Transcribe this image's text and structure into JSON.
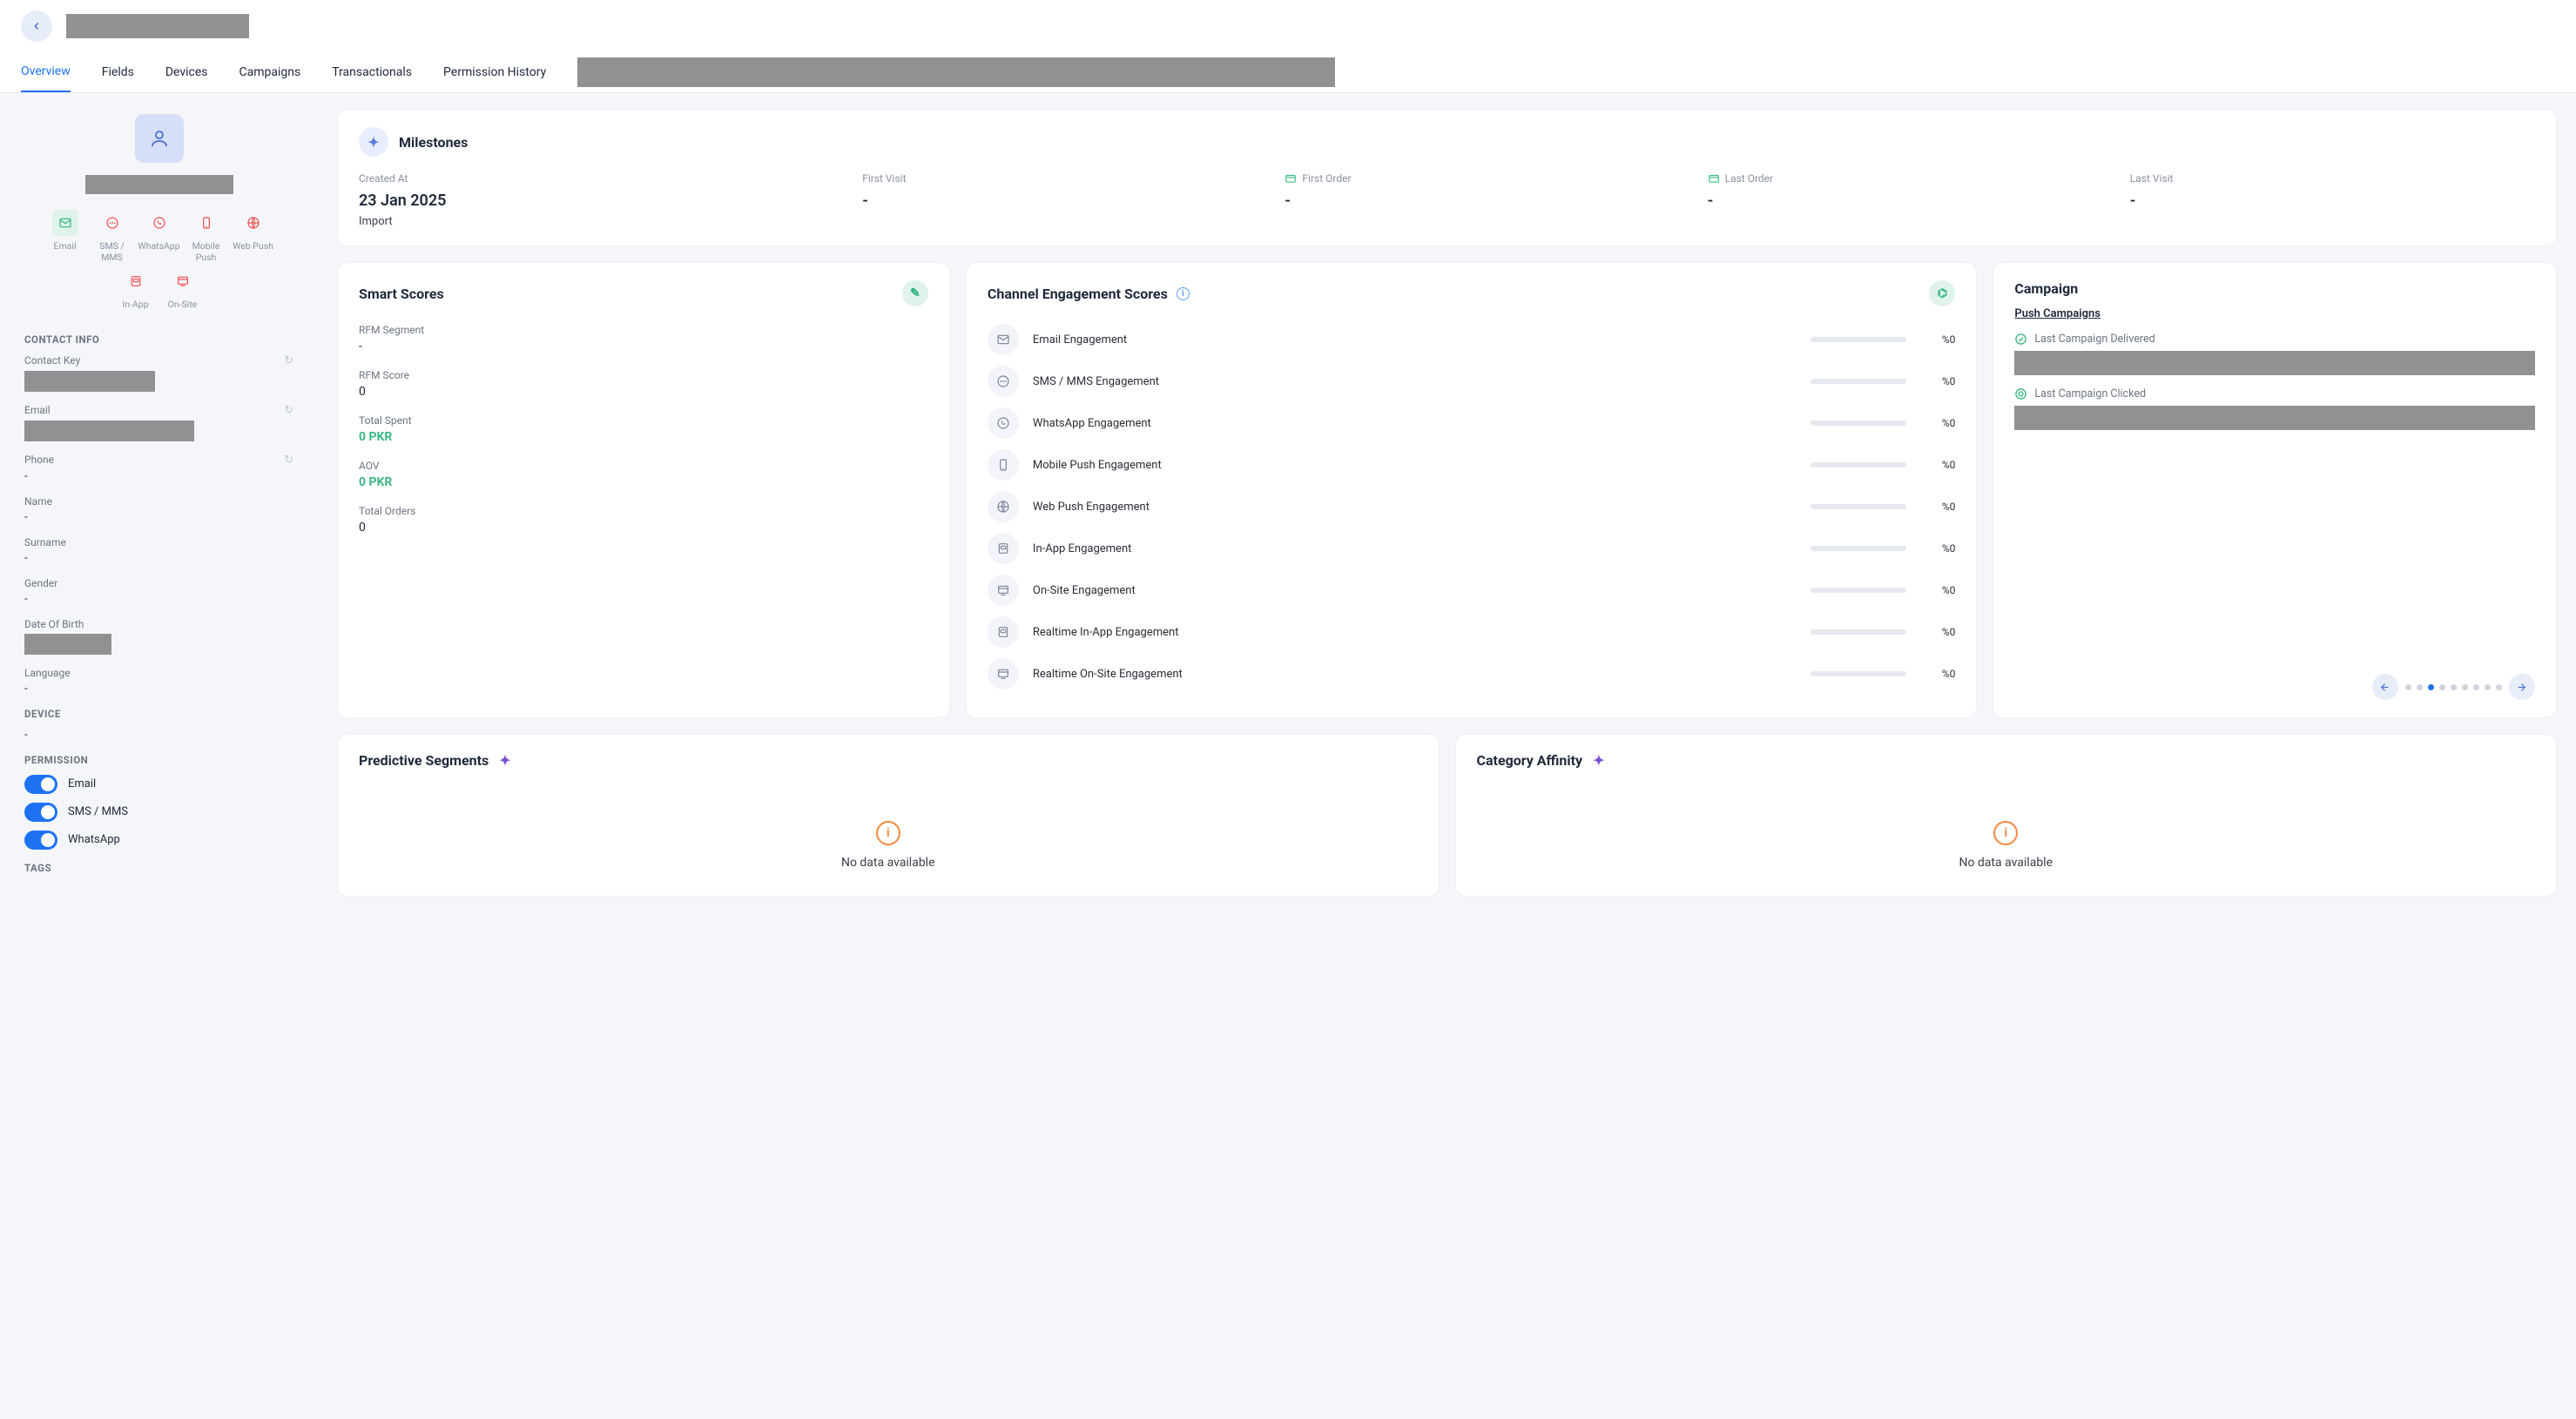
{
  "header": {
    "back_aria": "Back"
  },
  "tabs": {
    "items": [
      "Overview",
      "Fields",
      "Devices",
      "Campaigns",
      "Transactionals",
      "Permission History"
    ],
    "active_index": 0
  },
  "sidebar": {
    "channels": [
      {
        "label": "Email",
        "icon": "mail",
        "state": "green"
      },
      {
        "label": "SMS / MMS",
        "icon": "chat",
        "state": "red"
      },
      {
        "label": "WhatsApp",
        "icon": "whatsapp",
        "state": "red"
      },
      {
        "label": "Mobile Push",
        "icon": "mobile",
        "state": "red"
      },
      {
        "label": "Web Push",
        "icon": "globe",
        "state": "red"
      },
      {
        "label": "In-App",
        "icon": "inapp",
        "state": "red"
      },
      {
        "label": "On-Site",
        "icon": "onsite",
        "state": "red"
      }
    ],
    "contact_info_title": "CONTACT INFO",
    "fields": [
      {
        "label": "Contact Key",
        "value": null,
        "placeholder": true,
        "refresh": true,
        "ph_w": 150
      },
      {
        "label": "Email",
        "value": null,
        "placeholder": true,
        "refresh": true,
        "ph_w": 195
      },
      {
        "label": "Phone",
        "value": "-",
        "refresh": true
      },
      {
        "label": "Name",
        "value": "-"
      },
      {
        "label": "Surname",
        "value": "-"
      },
      {
        "label": "Gender",
        "value": "-"
      },
      {
        "label": "Date Of Birth",
        "value": null,
        "placeholder": true,
        "ph_w": 100
      },
      {
        "label": "Language",
        "value": "-"
      }
    ],
    "device_title": "DEVICE",
    "device_value": "-",
    "permission_title": "PERMISSION",
    "permissions": [
      {
        "label": "Email",
        "on": true
      },
      {
        "label": "SMS / MMS",
        "on": true
      },
      {
        "label": "WhatsApp",
        "on": true
      }
    ],
    "tags_title": "TAGS"
  },
  "milestones": {
    "title": "Milestones",
    "items": [
      {
        "label": "Created At",
        "value": "23 Jan 2025",
        "sub": "Import"
      },
      {
        "label": "First Visit",
        "value": "-"
      },
      {
        "label": "First Order",
        "value": "-",
        "cc": true
      },
      {
        "label": "Last Order",
        "value": "-",
        "cc": true
      },
      {
        "label": "Last Visit",
        "value": "-"
      }
    ]
  },
  "smart": {
    "title": "Smart Scores",
    "scores": [
      {
        "label": "RFM Segment",
        "value": "-"
      },
      {
        "label": "RFM Score",
        "value": "0"
      },
      {
        "label": "Total Spent",
        "value": "0 PKR",
        "green": true
      },
      {
        "label": "AOV",
        "value": "0 PKR",
        "green": true
      },
      {
        "label": "Total Orders",
        "value": "0"
      }
    ]
  },
  "engagement": {
    "title": "Channel Engagement Scores",
    "rows": [
      {
        "label": "Email Engagement",
        "pct": "%0",
        "icon": "mail"
      },
      {
        "label": "SMS / MMS Engagement",
        "pct": "%0",
        "icon": "chat"
      },
      {
        "label": "WhatsApp Engagement",
        "pct": "%0",
        "icon": "whatsapp"
      },
      {
        "label": "Mobile Push Engagement",
        "pct": "%0",
        "icon": "mobile"
      },
      {
        "label": "Web Push Engagement",
        "pct": "%0",
        "icon": "globe"
      },
      {
        "label": "In-App Engagement",
        "pct": "%0",
        "icon": "inapp"
      },
      {
        "label": "On-Site Engagement",
        "pct": "%0",
        "icon": "onsite"
      },
      {
        "label": "Realtime In-App Engagement",
        "pct": "%0",
        "icon": "inapp"
      },
      {
        "label": "Realtime On-Site Engagement",
        "pct": "%0",
        "icon": "onsite"
      }
    ]
  },
  "campaign": {
    "title": "Campaign",
    "sub": "Push Campaigns",
    "items": [
      {
        "label": "Last Campaign Delivered",
        "icon": "check"
      },
      {
        "label": "Last Campaign Clicked",
        "icon": "target"
      }
    ],
    "pager": {
      "count": 9,
      "active": 2
    }
  },
  "predictive": {
    "title": "Predictive Segments",
    "nodata": "No data available"
  },
  "affinity": {
    "title": "Category Affinity",
    "nodata": "No data available"
  }
}
